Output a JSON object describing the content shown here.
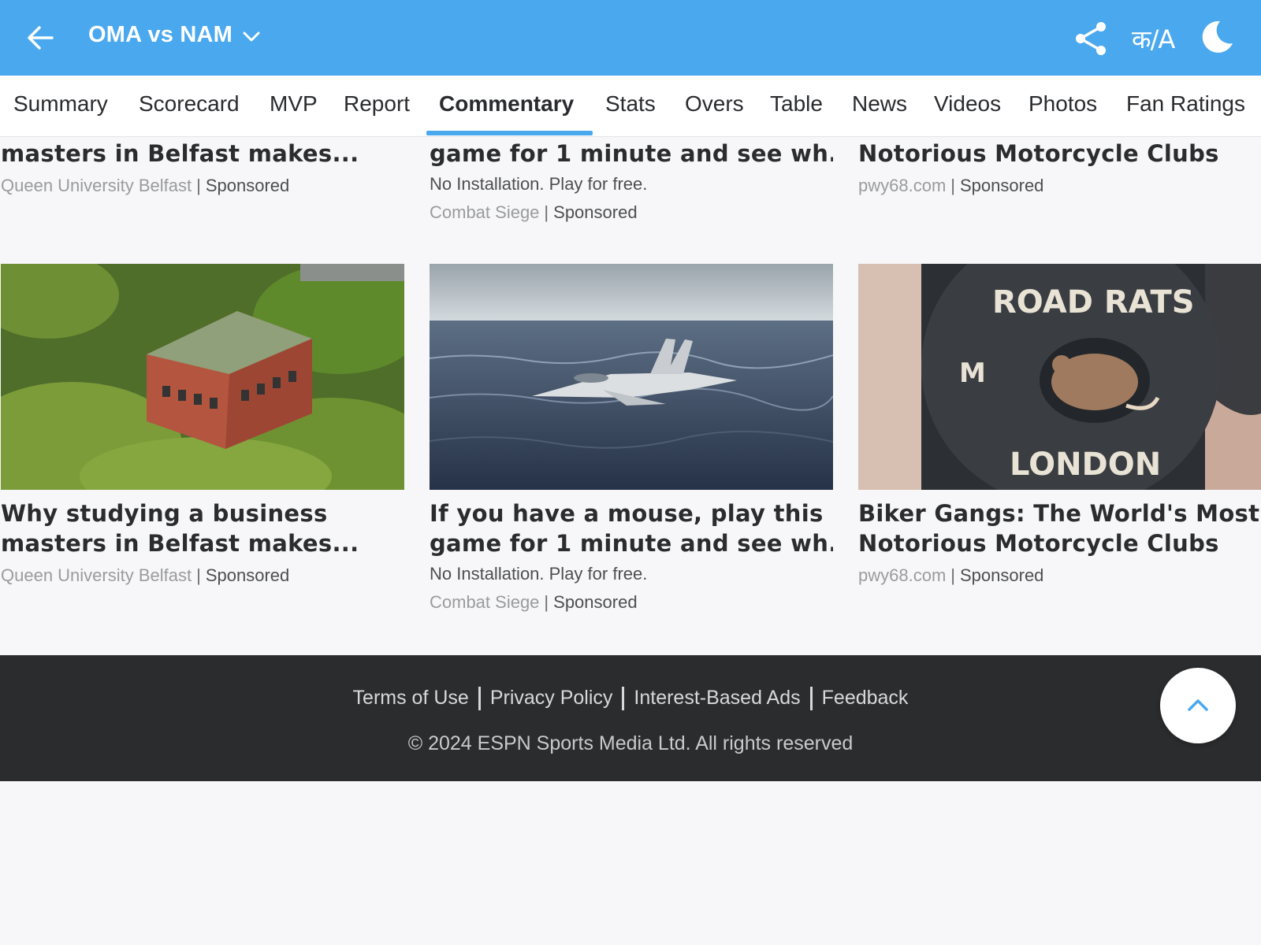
{
  "header": {
    "match_title": "OMA vs NAM",
    "lang_toggle": "क/A",
    "colors": {
      "bar": "#4aa8ee",
      "text": "#ffffff"
    }
  },
  "tabs": [
    {
      "label": "Summary"
    },
    {
      "label": "Scorecard"
    },
    {
      "label": "MVP"
    },
    {
      "label": "Report"
    },
    {
      "label": "Commentary",
      "active": true
    },
    {
      "label": "Stats"
    },
    {
      "label": "Overs"
    },
    {
      "label": "Table"
    },
    {
      "label": "News"
    },
    {
      "label": "Videos"
    },
    {
      "label": "Photos"
    },
    {
      "label": "Fan Ratings"
    }
  ],
  "ads_top": [
    {
      "title_line2": "masters in Belfast makes...",
      "source": "Queen University Belfast",
      "sponsored": "Sponsored"
    },
    {
      "title_line2": "game for 1 minute and see wh...",
      "desc": "No Installation. Play for free.",
      "source": "Combat Siege",
      "sponsored": "Sponsored"
    },
    {
      "title_line2": "Notorious Motorcycle Clubs",
      "source": "pwy68.com",
      "sponsored": "Sponsored"
    }
  ],
  "ads": [
    {
      "image": "university-building-aerial",
      "title_line1": "Why studying a business",
      "title_line2": "masters in Belfast makes...",
      "source": "Queen University Belfast",
      "sponsored": "Sponsored"
    },
    {
      "image": "fighter-jet-over-sea",
      "title_line1": "If you have a mouse, play this",
      "title_line2": "game for 1 minute and see wh...",
      "desc": "No Installation. Play for free.",
      "source": "Combat Siege",
      "sponsored": "Sponsored"
    },
    {
      "image": "biker-vest-road-rats-london",
      "image_text": {
        "top": "ROAD RATS",
        "bottom": "LONDON",
        "side": "M"
      },
      "title_line1": "Biker Gangs: The World's Most",
      "title_line2": "Notorious Motorcycle Clubs",
      "source": "pwy68.com",
      "sponsored": "Sponsored"
    }
  ],
  "footer": {
    "links": [
      "Terms of Use",
      "Privacy Policy",
      "Interest-Based Ads",
      "Feedback"
    ],
    "copyright": "© 2024 ESPN Sports Media Ltd. All rights reserved"
  },
  "icons": {
    "back": "arrow-left-icon",
    "dropdown": "chevron-down-icon",
    "share": "share-icon",
    "language": "language-toggle-icon",
    "theme": "moon-icon",
    "scroll_top": "chevron-up-icon"
  }
}
